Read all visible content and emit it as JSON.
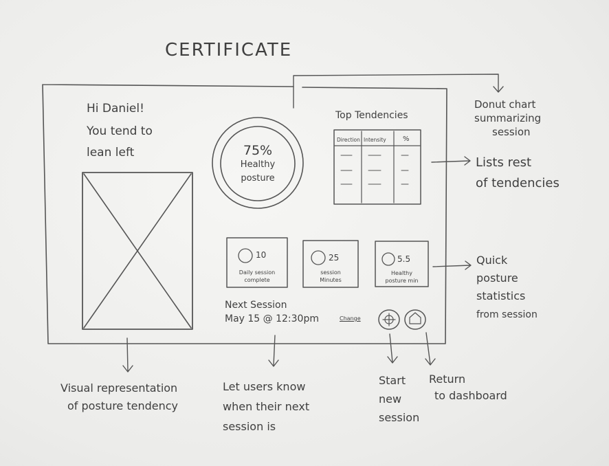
{
  "title": "CERTIFICATE",
  "greeting": {
    "line1": "Hi Daniel!",
    "line2": "You tend to",
    "line3": "lean left"
  },
  "donut": {
    "value": "75%",
    "label1": "Healthy",
    "label2": "posture"
  },
  "tendencies": {
    "title": "Top Tendencies",
    "columns": [
      "Direction",
      "Intensity",
      "%"
    ]
  },
  "stats": [
    {
      "value": "10",
      "label1": "Daily session",
      "label2": "complete"
    },
    {
      "value": "25",
      "label1": "session",
      "label2": "Minutes"
    },
    {
      "value": "5.5",
      "label1": "Healthy",
      "label2": "posture min"
    }
  ],
  "next_session": {
    "label": "Next Session",
    "date": "May 15 @ 12:30pm",
    "change": "Change"
  },
  "annotations": {
    "donut": [
      "Donut chart",
      "summarizing",
      "session"
    ],
    "tendencies": [
      "Lists rest",
      "of tendencies"
    ],
    "stats": [
      "Quick",
      "posture",
      "statistics",
      "from session"
    ],
    "visual": [
      "Visual representation",
      "of posture tendency"
    ],
    "next": [
      "Let users know",
      "when their next",
      "session is"
    ],
    "start": [
      "Start",
      "new",
      "session"
    ],
    "return": [
      "Return",
      "to dashboard"
    ]
  }
}
